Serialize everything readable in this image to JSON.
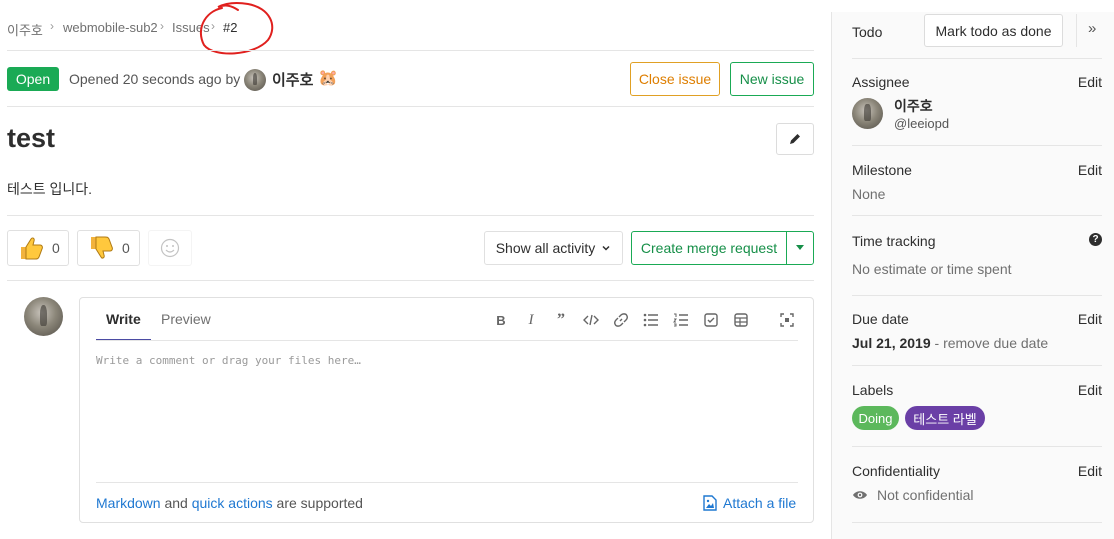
{
  "breadcrumb": {
    "items": [
      "이주호",
      "webmobile-sub2",
      "Issues"
    ],
    "current": "#2",
    "separator": "›"
  },
  "issue": {
    "status": "Open",
    "opened_text": "Opened 20 seconds ago by",
    "author_name": "이주호",
    "author_emoji": "🐹",
    "title": "test",
    "description": "테스트 입니다.",
    "close_button": "Close issue",
    "new_button": "New issue"
  },
  "awards": {
    "thumbs_up_count": "0",
    "thumbs_down_count": "0"
  },
  "activity": {
    "filter_label": "Show all activity",
    "merge_request_label": "Create merge request"
  },
  "comment": {
    "tab_write": "Write",
    "tab_preview": "Preview",
    "placeholder": "Write a comment or drag your files here…",
    "footer_markdown": "Markdown",
    "footer_and": " and ",
    "footer_quick_actions": "quick actions",
    "footer_supported": " are supported",
    "attach_label": "Attach a file"
  },
  "sidebar": {
    "todo_title": "Todo",
    "todo_button": "Mark todo as done",
    "collapse_icon": "»",
    "assignee_title": "Assignee",
    "assignee_name": "이주호",
    "assignee_handle": "@leeiopd",
    "milestone_title": "Milestone",
    "milestone_value": "None",
    "time_tracking_title": "Time tracking",
    "time_tracking_value": "No estimate or time spent",
    "due_date_title": "Due date",
    "due_date_value": "Jul 21, 2019",
    "due_date_remove": " - remove due date",
    "labels_title": "Labels",
    "labels": [
      {
        "name": "Doing",
        "color": "#5cb85c"
      },
      {
        "name": "테스트 라벨",
        "color": "#6a3fa6"
      }
    ],
    "confidentiality_title": "Confidentiality",
    "confidentiality_value": "Not confidential",
    "edit_label": "Edit"
  },
  "colors": {
    "open_badge": "#1aaa55",
    "close_issue": "#de7e00",
    "link": "#1f78d1",
    "annotation": "#e0201e"
  }
}
